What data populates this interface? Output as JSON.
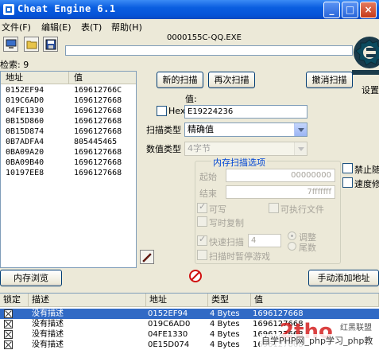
{
  "window": {
    "title": "Cheat Engine 6.1"
  },
  "menu": [
    "文件(F)",
    "编辑(E)",
    "表(T)",
    "帮助(H)"
  ],
  "process_name": "0000155C-QQ.EXE",
  "found": {
    "label": "检索",
    "count": "9"
  },
  "results": {
    "col_address": "地址",
    "col_value": "值",
    "rows": [
      {
        "address": "0152EF94",
        "value": "169612766C"
      },
      {
        "address": "019C6AD0",
        "value": "1696127668"
      },
      {
        "address": "04FE1330",
        "value": "1696127668"
      },
      {
        "address": "0B15D860",
        "value": "1696127668"
      },
      {
        "address": "0B15D874",
        "value": "1696127668"
      },
      {
        "address": "0B7ADFA4",
        "value": "805445465"
      },
      {
        "address": "0BA09A20",
        "value": "1696127668"
      },
      {
        "address": "0BA09B40",
        "value": "1696127668"
      },
      {
        "address": "10197EE8",
        "value": "1696127668"
      }
    ]
  },
  "buttons": {
    "new_scan": "新的扫描",
    "next_scan": "再次扫描",
    "undo_scan": "撤消扫描",
    "memory_view": "内存浏览",
    "add_address": "手动添加地址"
  },
  "settings_label": "设置",
  "value_label": "值:",
  "hex_label": "Hex",
  "value_input": "E19224236",
  "scan_type": {
    "label": "扫描类型",
    "value": "精确值"
  },
  "value_type": {
    "label": "数值类型",
    "value": "4字节"
  },
  "memory_options": {
    "title": "内存扫描选项",
    "start_label": "起始",
    "start_value": "00000000",
    "end_label": "结束",
    "end_value": "7fffffff",
    "writable": "可写",
    "executable": "可执行文件",
    "copy_on_write": "写时复制",
    "fast_scan": "快速扫描",
    "fast_scan_value": "4",
    "alignment": "调整",
    "last_digits": "尾数",
    "pause": "扫描时暂停游戏"
  },
  "disable_random": "禁止随机",
  "speed_hack": "速度修改",
  "address_list": {
    "columns": [
      "锁定",
      "描述",
      "地址",
      "类型",
      "值"
    ],
    "rows": [
      {
        "desc": "没有描述",
        "address": "0152EF94",
        "type": "4 Bytes",
        "value": "1696127668",
        "selected": true
      },
      {
        "desc": "没有描述",
        "address": "019C6AD0",
        "type": "4 Bytes",
        "value": "1696127668",
        "selected": false
      },
      {
        "desc": "没有描述",
        "address": "04FE1330",
        "type": "4 Bytes",
        "value": "1696127668",
        "selected": false
      },
      {
        "desc": "没有描述",
        "address": "0E15D074",
        "type": "4 Bytes",
        "value": "1696127668",
        "selected": false
      }
    ]
  },
  "watermark": {
    "text": "自学PHP网_php学习_php教",
    "brand": "红黑联盟"
  },
  "colors": {
    "titlebar": "#0553d8",
    "selection": "#316ac5",
    "group_title": "#0046d5"
  }
}
